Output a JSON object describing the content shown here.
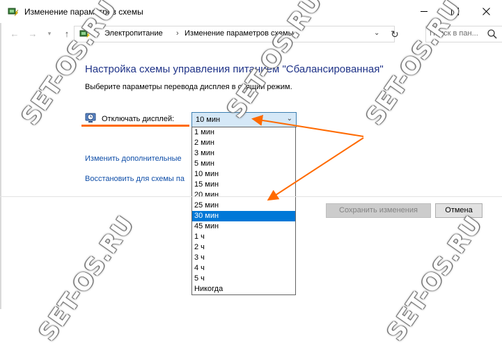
{
  "window": {
    "title": "Изменение параметров схемы"
  },
  "addressbar": {
    "breadcrumb_sep": "«",
    "crumb_separator": "›",
    "crumbs": [
      "Электропитание",
      "Изменение параметров схемы"
    ],
    "search_placeholder": "Поиск в пан..."
  },
  "content": {
    "heading": "Настройка схемы управления питанием \"Сбалансированная\"",
    "subheading": "Выберите параметры перевода дисплея в спящий режим.",
    "display_label": "Отключать дисплей:",
    "display_selected": "10 мин",
    "options": [
      "1 мин",
      "2 мин",
      "3 мин",
      "5 мин",
      "10 мин",
      "15 мин",
      "20 мин",
      "25 мин",
      "30 мин",
      "45 мин",
      "1 ч",
      "2 ч",
      "3 ч",
      "4 ч",
      "5 ч",
      "Никогда"
    ],
    "highlighted_option": "30 мин",
    "link_advanced": "Изменить дополнительные",
    "link_restore": "Восстановить для схемы па"
  },
  "buttons": {
    "save": "Сохранить изменения",
    "cancel": "Отмена"
  },
  "watermark": "SET-OS.RU",
  "colors": {
    "heading": "#1e3287",
    "link": "#0f4ea8",
    "highlight": "#0078d7",
    "annotation": "#ff6a00"
  }
}
